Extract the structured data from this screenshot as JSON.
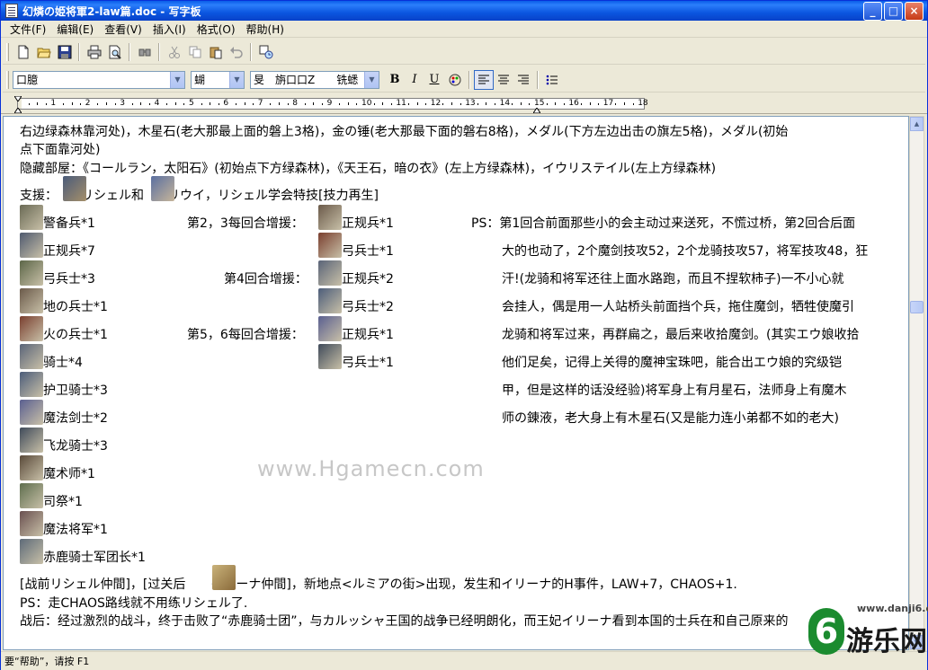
{
  "window": {
    "title": "幻燐の姫将軍2-law篇.doc - 写字板",
    "controls": [
      "_",
      "□",
      "×"
    ]
  },
  "menu": [
    "文件(F)",
    "编辑(E)",
    "查看(V)",
    "插入(I)",
    "格式(O)",
    "帮助(H)"
  ],
  "format_bar": {
    "font_name": "口臆",
    "font_size": "蝴",
    "script": "旻　旃口口Z　　铣蟋",
    "bold": "B",
    "italic": "I",
    "underline": "U"
  },
  "ruler": {
    "labels": [
      "1",
      "2",
      "3",
      "4",
      "5",
      "6",
      "7",
      "8",
      "9",
      "10",
      "11",
      "12",
      "13",
      "14",
      "15",
      "16",
      "17",
      "18"
    ]
  },
  "document": {
    "lines": [
      "右边绿森林靠河处)，木星石(老大那最上面的磐上3格)，金の锤(老大那最下面的磐右8格)，メダル(下方左边出击の旗左5格)，メダル(初始",
      "点下面靠河处)",
      "隐藏部屋：《コールラン，太阳石》(初始点下方绿森林)，《天王石，暗の衣》(左上方绿森林)，イウリステイル(左上方绿森林)"
    ],
    "support_prefix": "支援：",
    "support_mid1": "リシェル和",
    "support_mid2": "リウイ，リシェル学会特技[技力再生]",
    "enemies_left": [
      "警备兵*1",
      "正规兵*7",
      "弓兵士*3",
      "地の兵士*1",
      "火の兵士*1",
      "骑士*4",
      "护卫骑士*3",
      "魔法剑士*2",
      "飞龙骑士*3",
      "魔术师*1",
      "司祭*1",
      "魔法将军*1",
      "赤鹿骑士军团长*1"
    ],
    "reinforce_labels": [
      "第2，3每回合增援：",
      "第4回合增援：",
      "第5，6每回合增援："
    ],
    "enemies_mid": [
      "正规兵*1",
      "弓兵士*1",
      "正规兵*2",
      "弓兵士*2",
      "正规兵*1",
      "弓兵士*1"
    ],
    "ps_lines": [
      "PS：第1回合前面那些小的会主动过来送死，不慌过桥，第2回合后面",
      "大的也动了，2个魔剑技攻52，2个龙骑技攻57，将军技攻48，狂",
      "汗!(龙骑和将军还往上面水路跑，而且不捏软柿子)一不小心就",
      "会挂人，偶是用一人站桥头前面挡个兵，拖住魔剑，牺牲使魔引",
      "龙骑和将军过来，再群扁之，最后来收拾魔剑。(其实エウ娘收拾",
      "他们足矣，记得上关得的魔神宝珠吧，能合出エウ娘的究级铠",
      "甲，但是这样的话没经验)将军身上有月星石，法师身上有魔木",
      "师の錬液，老大身上有木星石(又是能力连小弟都不如的老大)"
    ],
    "after_prefix": "[战前リシェル仲間]，[过关后",
    "after_rest": "イリーナ仲間]，新地点<ルミアの街>出现，发生和イリーナ的H事件，LAW+7，CHAOS+1.",
    "ps2": "PS：走CHAOS路线就不用练リシェル了.",
    "battle": "战后：经过激烈的战斗，终于击败了“赤鹿骑士团”，与カルッシャ王国的战争已经明朗化，而王妃イリーナ看到本国的士兵在和自己原来的"
  },
  "watermark": "www.Hgamecn.com",
  "status": "要“帮助”，请按 F1",
  "logo": {
    "url": "www.danji6.com",
    "digit": "6",
    "name": "游乐网"
  },
  "colors": {
    "titlebar": "#0a5de8",
    "selection": "#316ac5"
  }
}
